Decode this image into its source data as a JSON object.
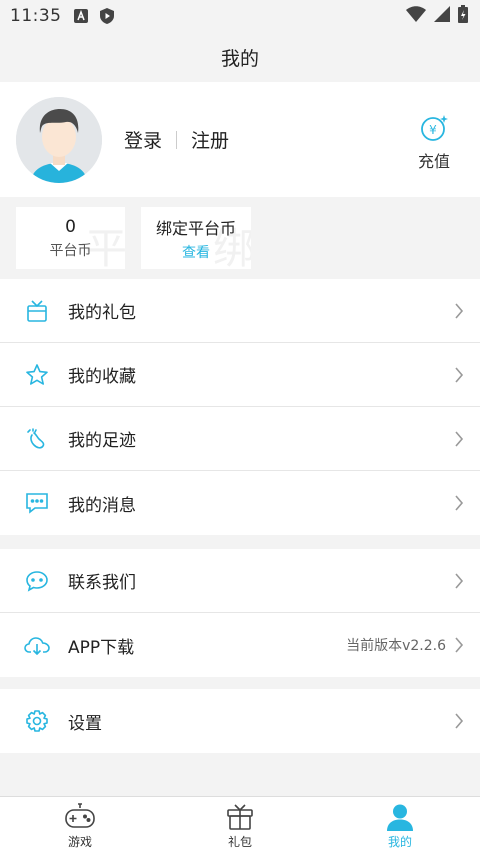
{
  "status_bar": {
    "time": "11:35"
  },
  "header": {
    "title": "我的"
  },
  "profile": {
    "login_label": "登录",
    "register_label": "注册",
    "recharge_label": "充值",
    "recharge_symbol": "¥"
  },
  "currency": {
    "platform": {
      "value": "0",
      "label": "平台币"
    },
    "bound": {
      "title": "绑定平台币",
      "link": "查看"
    }
  },
  "menu_primary": [
    {
      "label": "我的礼包",
      "icon": "gift-icon"
    },
    {
      "label": "我的收藏",
      "icon": "star-icon"
    },
    {
      "label": "我的足迹",
      "icon": "footprint-icon"
    },
    {
      "label": "我的消息",
      "icon": "message-icon"
    }
  ],
  "menu_secondary": [
    {
      "label": "联系我们",
      "icon": "chat-icon"
    },
    {
      "label": "APP下载",
      "icon": "cloud-download-icon",
      "extra": "当前版本v2.2.6"
    }
  ],
  "menu_settings": [
    {
      "label": "设置",
      "icon": "gear-icon"
    }
  ],
  "tabs": [
    {
      "label": "游戏",
      "icon": "gamepad-icon",
      "active": false
    },
    {
      "label": "礼包",
      "icon": "gift-box-icon",
      "active": false
    },
    {
      "label": "我的",
      "icon": "user-icon",
      "active": true
    }
  ],
  "colors": {
    "accent": "#28b6e0",
    "background": "#f3f3f3"
  }
}
